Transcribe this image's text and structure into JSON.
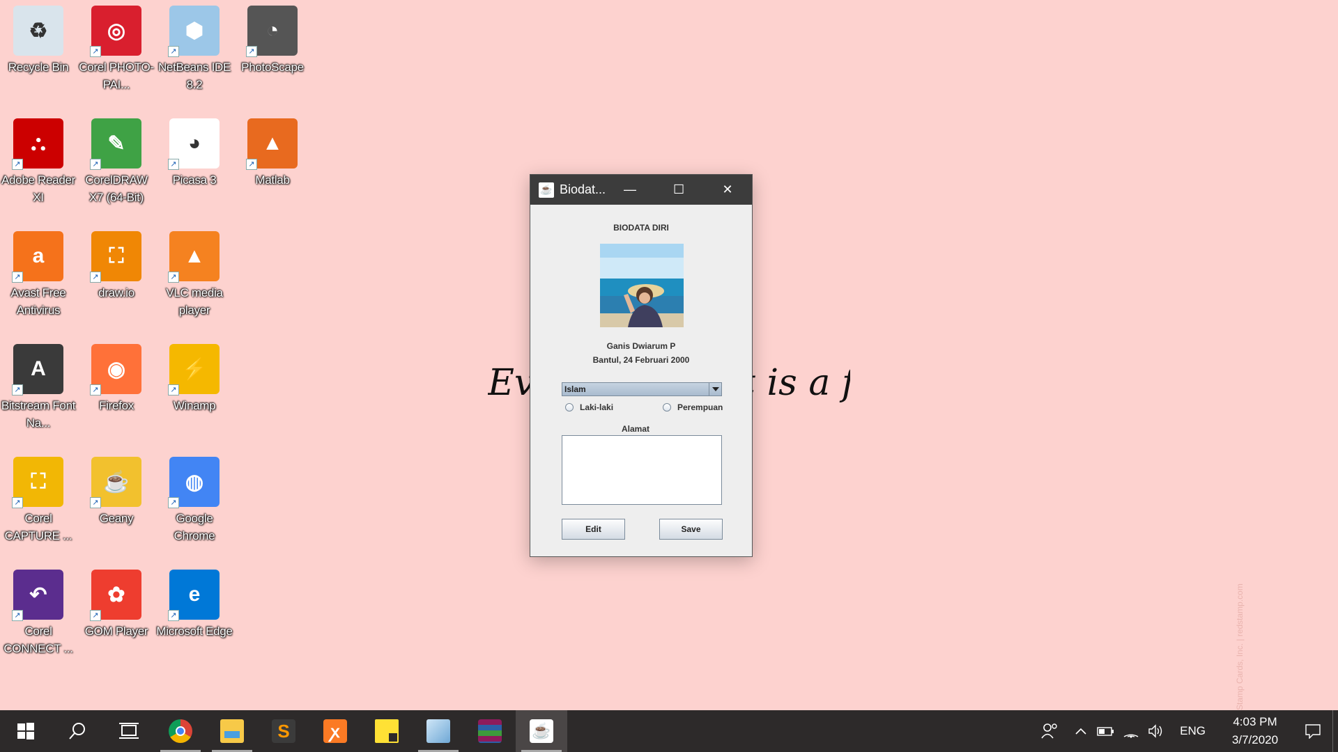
{
  "desktop": {
    "icons": [
      {
        "label": "Recycle Bin",
        "icon": "recycle-bin-icon",
        "color": "#d9e4ec"
      },
      {
        "label": "Corel PHOTO-PAI...",
        "icon": "corel-photopaint-icon",
        "color": "#d91f2e"
      },
      {
        "label": "NetBeans IDE 8.2",
        "icon": "netbeans-icon",
        "color": "#9cc7e8"
      },
      {
        "label": "PhotoScape",
        "icon": "photoscape-icon",
        "color": "#555555"
      },
      {
        "label": "Adobe Reader XI",
        "icon": "adobe-reader-icon",
        "color": "#cc0000"
      },
      {
        "label": "CorelDRAW X7 (64-Bit)",
        "icon": "coreldraw-icon",
        "color": "#3fa245"
      },
      {
        "label": "Picasa 3",
        "icon": "picasa-icon",
        "color": "#ffffff"
      },
      {
        "label": "Matlab",
        "icon": "matlab-icon",
        "color": "#e86a1f"
      },
      {
        "label": "Avast Free Antivirus",
        "icon": "avast-icon",
        "color": "#f5721b"
      },
      {
        "label": "draw.io",
        "icon": "drawio-icon",
        "color": "#f08705"
      },
      {
        "label": "VLC media player",
        "icon": "vlc-icon",
        "color": "#f58220"
      },
      {
        "label": "Bitstream Font Na...",
        "icon": "bitstream-font-navigator-icon",
        "color": "#3a3a3a"
      },
      {
        "label": "Firefox",
        "icon": "firefox-icon",
        "color": "#ff7139"
      },
      {
        "label": "Winamp",
        "icon": "winamp-icon",
        "color": "#f5b800"
      },
      {
        "label": "Corel CAPTURE ...",
        "icon": "corel-capture-icon",
        "color": "#f2b705"
      },
      {
        "label": "Geany",
        "icon": "geany-icon",
        "color": "#f2c12e"
      },
      {
        "label": "Google Chrome",
        "icon": "google-chrome-icon",
        "color": "#4285f4"
      },
      {
        "label": "Corel CONNECT ...",
        "icon": "corel-connect-icon",
        "color": "#5b2d8e"
      },
      {
        "label": "GOM Player",
        "icon": "gom-player-icon",
        "color": "#ee3d2f"
      },
      {
        "label": "Microsoft Edge",
        "icon": "microsoft-edge-icon",
        "color": "#0078d7"
      }
    ],
    "handwriting_text": "Every moment is a fresh start.",
    "watermark": "Stamp Cards, Inc. | redstamp.com",
    "background_color": "#fdd2cf"
  },
  "window": {
    "title": "Biodat...",
    "heading": "BIODATA DIRI",
    "photo_alt": "profile photo",
    "name": "Ganis Dwiarum P",
    "birth": "Bantul, 24 Februari 2000",
    "religion": {
      "selected": "Islam"
    },
    "gender": {
      "male_label": "Laki-laki",
      "female_label": "Perempuan"
    },
    "address": {
      "label": "Alamat",
      "value": ""
    },
    "edit_label": "Edit",
    "save_label": "Save"
  },
  "taskbar": {
    "apps": [
      {
        "name": "start",
        "icon": "windows-start-icon"
      },
      {
        "name": "search",
        "icon": "search-icon"
      },
      {
        "name": "task-view",
        "icon": "task-view-icon"
      },
      {
        "name": "chrome",
        "icon": "google-chrome-icon"
      },
      {
        "name": "file-explorer",
        "icon": "folder-icon"
      },
      {
        "name": "sublime-text",
        "icon": "sublime-text-icon"
      },
      {
        "name": "xampp",
        "icon": "xampp-icon"
      },
      {
        "name": "sticky-notes",
        "icon": "sticky-notes-icon"
      },
      {
        "name": "netbeans",
        "icon": "netbeans-icon"
      },
      {
        "name": "winrar",
        "icon": "winrar-icon"
      },
      {
        "name": "java",
        "icon": "java-icon"
      }
    ],
    "language": "ENG",
    "time": "4:03 PM",
    "date": "3/7/2020"
  }
}
